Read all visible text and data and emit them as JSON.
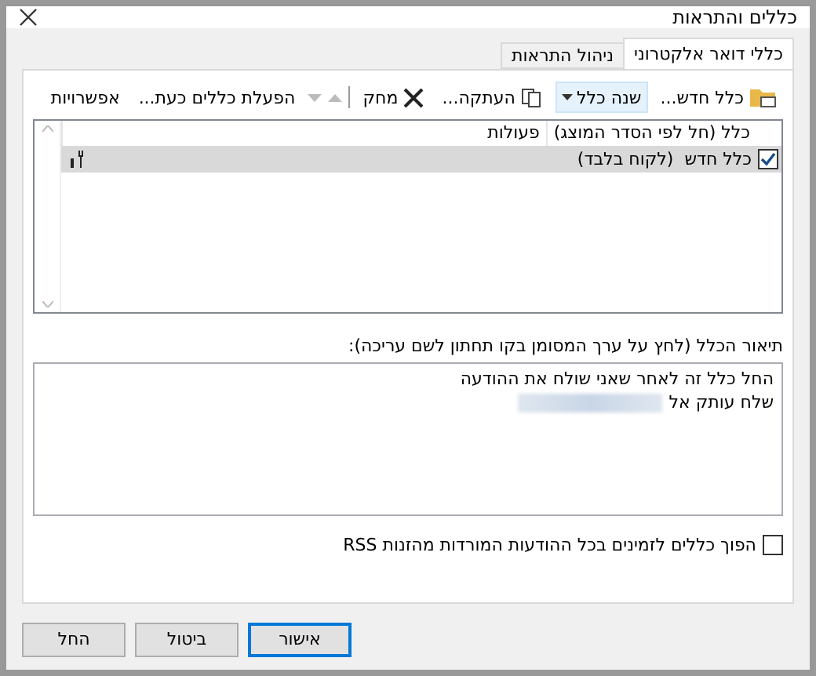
{
  "window": {
    "title": "כללים והתראות"
  },
  "tabs": [
    {
      "label": "כללי דואר אלקטרוני",
      "selected": true
    },
    {
      "label": "ניהול התראות",
      "selected": false
    }
  ],
  "toolbar": [
    {
      "kind": "new",
      "label": "כלל חדש...",
      "disabled": false
    },
    {
      "kind": "change",
      "label": "שנה כלל",
      "disabled": false
    },
    {
      "kind": "copy",
      "label": "העתקה...",
      "disabled": false
    },
    {
      "kind": "delete",
      "label": "מחק",
      "disabled": false
    },
    {
      "kind": "up",
      "disabled": true
    },
    {
      "kind": "down",
      "disabled": true
    },
    {
      "kind": "run",
      "label": "הפעלת כללים כעת...",
      "disabled": false
    },
    {
      "kind": "options",
      "label": "אפשרויות",
      "disabled": false
    }
  ],
  "table": {
    "columns": [
      "כלל (חל לפי הסדר המוצג)",
      "פעולות"
    ],
    "rows": [
      {
        "name": "כלל חדש  (לקוח בלבד)",
        "checked": true,
        "selected": true
      }
    ]
  },
  "description": {
    "label": "תיאור הכלל (לחץ על ערך המסומן בקו תחתון לשם עריכה):",
    "lines": [
      "החל כלל זה לאחר שאני שולח את ההודעה",
      "שלח עותק אל"
    ]
  },
  "rss": {
    "label": "הפוך כללים לזמינים בכל ההודעות המורדות מהזנות RSS",
    "checked": false
  },
  "buttons": [
    {
      "label": "אישור",
      "default": true
    },
    {
      "label": "ביטול",
      "default": false
    },
    {
      "label": "החל",
      "default": false
    }
  ]
}
